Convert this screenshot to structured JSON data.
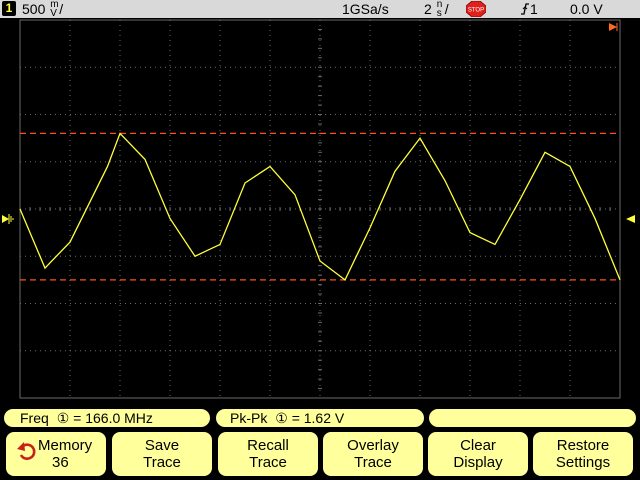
{
  "status_bar": {
    "channel_number": "1",
    "scale_value": "500",
    "scale_unit_top": "m",
    "scale_unit_bottom": "V",
    "scale_suffix": "/",
    "sample_rate": "1GSa/s",
    "time_scale_value": "2",
    "time_scale_unit_top": "n",
    "time_scale_unit_bottom": "s",
    "time_scale_suffix": "/",
    "run_state": "STOP",
    "trigger_source": "1",
    "trigger_level": "0.0 V"
  },
  "measurements": {
    "freq_label": "Freq",
    "freq_channel": "①",
    "freq_value": "= 166.0 MHz",
    "pkpk_label": "Pk-Pk",
    "pkpk_channel": "①",
    "pkpk_value": "=  1.62  V",
    "empty_slot": ""
  },
  "softkeys": [
    {
      "line1": "Memory",
      "line2": "36"
    },
    {
      "line1": "Save",
      "line2": "Trace"
    },
    {
      "line1": "Recall",
      "line2": "Trace"
    },
    {
      "line1": "Overlay",
      "line2": "Trace"
    },
    {
      "line1": "Clear",
      "line2": "Display"
    },
    {
      "line1": "Restore",
      "line2": "Settings"
    }
  ],
  "colors": {
    "trace": "#ffff3a",
    "cursor_lines": "#ff5020",
    "grid": "#6a6a6a",
    "softkey_bg": "#ffff9c",
    "status_bg": "#d9d9d9"
  },
  "waveform": {
    "volts_per_div": 0.5,
    "ns_per_div": 2,
    "cursor_top_div": 1.6,
    "cursor_bottom_div": -1.5,
    "trace_divs": [
      [
        0.0,
        0.0
      ],
      [
        0.5,
        -1.25
      ],
      [
        1.0,
        -0.7
      ],
      [
        1.75,
        0.9
      ],
      [
        2.0,
        1.6
      ],
      [
        2.5,
        1.05
      ],
      [
        3.0,
        -0.2
      ],
      [
        3.5,
        -1.0
      ],
      [
        4.0,
        -0.75
      ],
      [
        4.5,
        0.55
      ],
      [
        5.0,
        0.9
      ],
      [
        5.5,
        0.3
      ],
      [
        6.0,
        -1.1
      ],
      [
        6.5,
        -1.5
      ],
      [
        7.0,
        -0.4
      ],
      [
        7.5,
        0.8
      ],
      [
        8.0,
        1.5
      ],
      [
        8.5,
        0.6
      ],
      [
        9.0,
        -0.5
      ],
      [
        9.5,
        -0.75
      ],
      [
        10.0,
        0.2
      ],
      [
        10.5,
        1.2
      ],
      [
        11.0,
        0.9
      ],
      [
        11.5,
        -0.2
      ],
      [
        12.0,
        -1.5
      ]
    ]
  }
}
